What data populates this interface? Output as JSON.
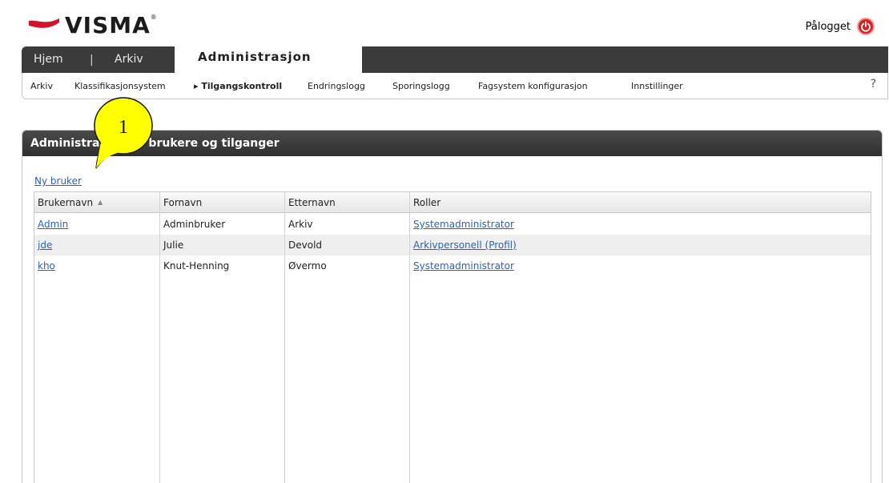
{
  "brand": {
    "name": "VISMA",
    "reg": "®",
    "color": "#d4122e"
  },
  "user_area": {
    "label": "Pålogget",
    "icon": "power-icon"
  },
  "top_nav": {
    "tabs": [
      {
        "label": "Hjem"
      },
      {
        "label": "Arkiv"
      },
      {
        "label": "Administrasjon"
      }
    ],
    "separator": "|"
  },
  "sub_nav": {
    "items": [
      {
        "label": "Arkiv"
      },
      {
        "label": "Klassifikasjonsystem"
      },
      {
        "label": "Tilgangskontroll"
      },
      {
        "label": "Endringslogg"
      },
      {
        "label": "Sporingslogg"
      },
      {
        "label": "Fagsystem konfigurasjon"
      },
      {
        "label": "Innstillinger"
      }
    ],
    "current_marker": "▸",
    "help": "?"
  },
  "panel": {
    "title": "Administrasjon av brukere og tilganger",
    "new_user_link": "Ny bruker"
  },
  "table": {
    "columns": [
      "Brukernavn",
      "Fornavn",
      "Etternavn",
      "Roller"
    ],
    "sort_icon": "▲",
    "rows": [
      {
        "username": "Admin",
        "first": "Adminbruker",
        "last": "Arkiv",
        "role": "Systemadministrator"
      },
      {
        "username": "jde",
        "first": "Julie",
        "last": "Devold",
        "role": "Arkivpersonell (Profil)"
      },
      {
        "username": "kho",
        "first": "Knut-Henning",
        "last": "Øvermo",
        "role": "Systemadministrator"
      }
    ]
  },
  "callout": {
    "label": "1",
    "color": "#ffff00"
  }
}
